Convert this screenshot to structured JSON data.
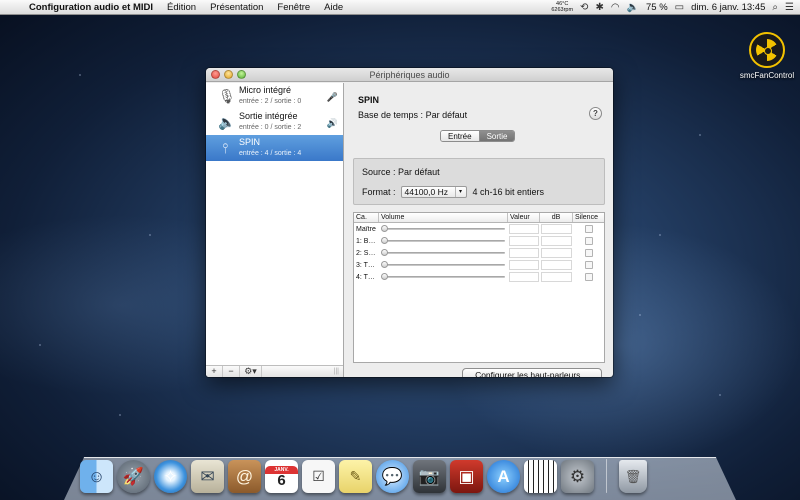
{
  "menubar": {
    "app_name": "Configuration audio et MIDI",
    "menus": [
      "Édition",
      "Présentation",
      "Fenêtre",
      "Aide"
    ],
    "cpu_temp": "46°C",
    "fan_rpm": "6263rpm",
    "battery": "75 %",
    "datetime": "dim. 6 janv.  13:45"
  },
  "desktop": {
    "icon_label": "smcFanControl"
  },
  "window": {
    "title": "Périphériques audio",
    "devices": [
      {
        "name": "Micro intégré",
        "sub": "entrée : 2 / sortie : 0",
        "icon": "microphone-icon",
        "badge": "🎤"
      },
      {
        "name": "Sortie intégrée",
        "sub": "entrée : 0 / sortie : 2",
        "icon": "speaker-icon",
        "badge": "🔊"
      },
      {
        "name": "SPIN",
        "sub": "entrée : 4 / sortie : 4",
        "icon": "usb-icon",
        "badge": ""
      }
    ],
    "sidebar_buttons": {
      "add": "+",
      "remove": "−",
      "gear": "⚙▾"
    },
    "selected_device": "SPIN",
    "clock_label": "Base de temps :",
    "clock_value": "Par défaut",
    "help": "?",
    "tabs": {
      "input": "Entrée",
      "output": "Sortie",
      "selected": "output"
    },
    "source_label": "Source :",
    "source_value": "Par défaut",
    "format_label": "Format :",
    "format_value": "44100,0 Hz",
    "format_bits": "4 ch-16 bit entiers",
    "table": {
      "headers": {
        "channel": "Ca.",
        "volume": "Volume",
        "value": "Valeur",
        "db": "dB",
        "mute": "Silence"
      },
      "rows": [
        "Maître",
        "1: B…",
        "2: S…",
        "3: T…",
        "4: T…"
      ]
    },
    "configure_button": "Configurer les haut-parleurs…"
  },
  "dock": {
    "apps": [
      "finder-icon",
      "launchpad-icon",
      "safari-icon",
      "mail-icon",
      "contacts-icon",
      "calendar-icon",
      "reminders-icon",
      "notes-icon",
      "messages-icon",
      "facetime-icon",
      "photo-booth-icon",
      "app-store-icon",
      "audio-midi-icon",
      "system-preferences-icon",
      "trash-icon"
    ],
    "calendar_day": "6",
    "calendar_month": "JANV."
  }
}
